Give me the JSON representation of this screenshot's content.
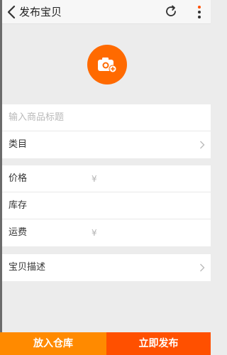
{
  "header": {
    "title": "发布宝贝",
    "back_icon": "chevron-left-icon",
    "refresh_icon": "refresh-icon",
    "more_icon": "more-vertical-icon"
  },
  "photo": {
    "icon": "add-photo-camera-icon",
    "color": "#ff6a00"
  },
  "form": {
    "title_placeholder": "输入商品标题",
    "category_label": "类目",
    "price_label": "价格",
    "price_currency": "¥",
    "stock_label": "库存",
    "shipping_label": "运费",
    "shipping_currency": "¥",
    "description_label": "宝贝描述"
  },
  "footer": {
    "store_label": "放入仓库",
    "publish_label": "立即发布",
    "store_color": "#ff8a00",
    "publish_color": "#ff5000"
  }
}
